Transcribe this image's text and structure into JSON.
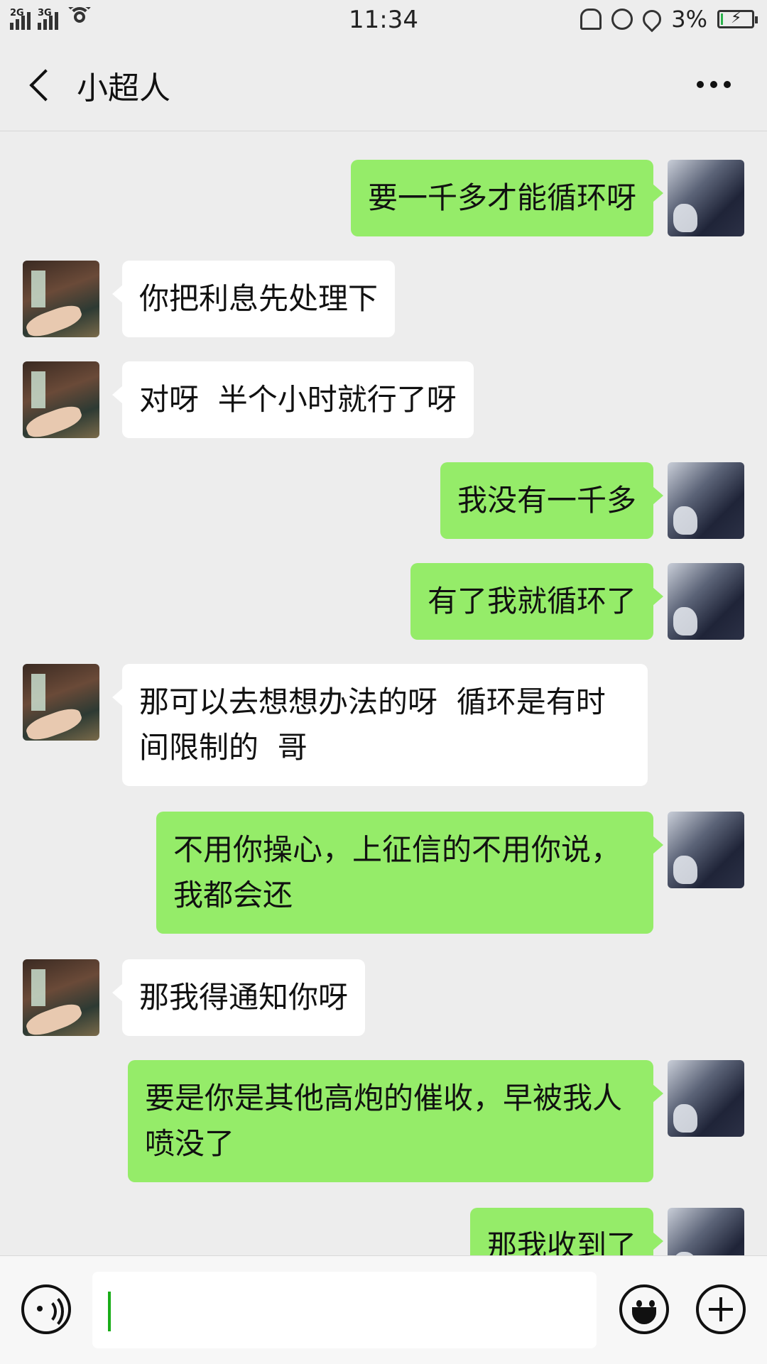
{
  "status_bar": {
    "network_1": "2G",
    "network_2": "3G",
    "time": "11:34",
    "battery_percent": "3%"
  },
  "header": {
    "title": "小超人",
    "back_icon": "chevron-left-icon",
    "more_icon": "more-dots-icon"
  },
  "messages": [
    {
      "side": "self",
      "text": "要一千多才能循环呀"
    },
    {
      "side": "other",
      "text": "你把利息先处理下"
    },
    {
      "side": "other",
      "text": "对呀  半个小时就行了呀"
    },
    {
      "side": "self",
      "text": "我没有一千多"
    },
    {
      "side": "self",
      "text": "有了我就循环了"
    },
    {
      "side": "other",
      "text": "那可以去想想办法的呀  循环是有时间限制的  哥"
    },
    {
      "side": "self",
      "text": "不用你操心，上征信的不用你说，我都会还"
    },
    {
      "side": "other",
      "text": "那我得通知你呀"
    },
    {
      "side": "self",
      "text": "要是你是其他高炮的催收，早被我人喷没了"
    },
    {
      "side": "self",
      "text": "那我收到了"
    }
  ],
  "input_bar": {
    "text_value": "",
    "voice_icon": "voice-icon",
    "emoji_icon": "emoji-icon",
    "plus_icon": "plus-icon"
  },
  "colors": {
    "self_bubble": "#95ec69",
    "other_bubble": "#ffffff",
    "background": "#ededed"
  }
}
